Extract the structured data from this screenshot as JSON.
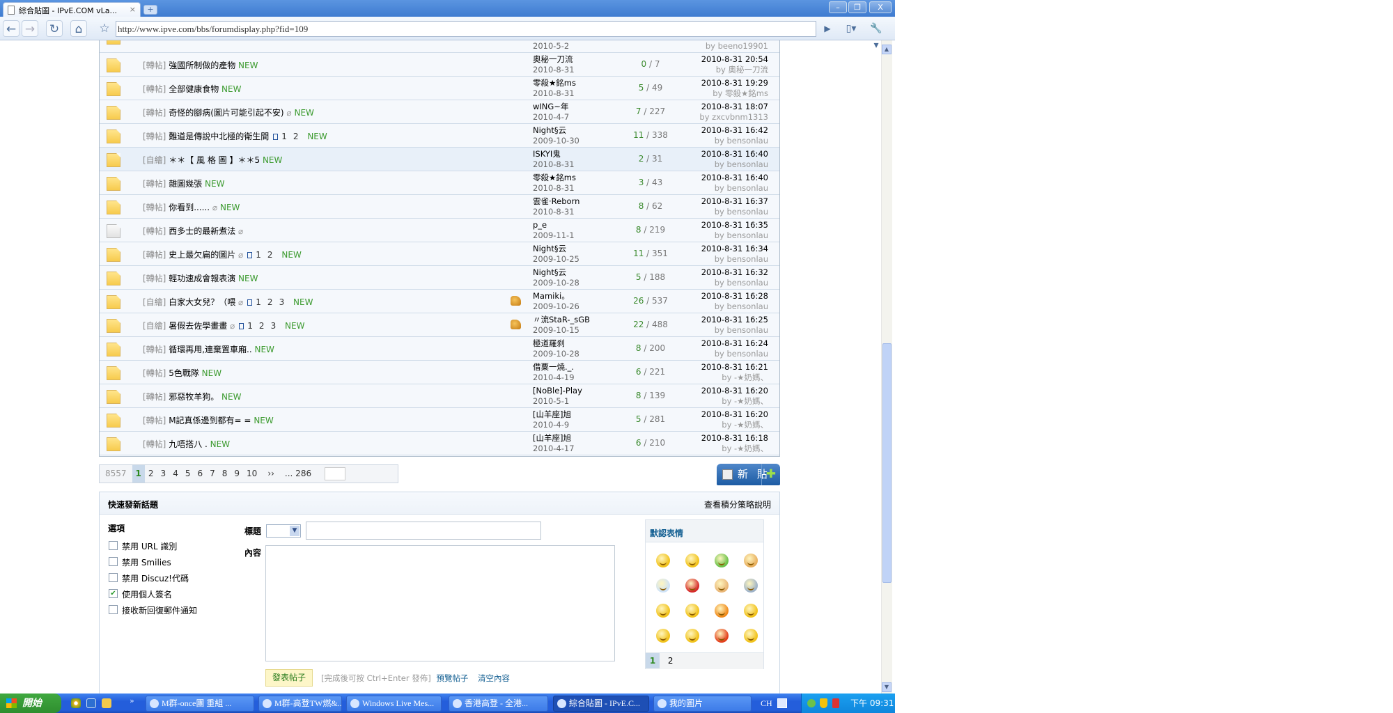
{
  "browser": {
    "tab_title": "綜合貼圖 - IPvE.COM vLa...",
    "url": "http://www.ipve.com/bbs/forumdisplay.php?fid=109"
  },
  "partial_row": {
    "date": "2010-5-2",
    "last_by": "by beeno19901"
  },
  "rows": [
    {
      "prefix": "[轉帖]",
      "title": "強國所制做的產物",
      "attach": false,
      "pages": [],
      "new": "NEW",
      "thumb": false,
      "icon": "new",
      "highlight": false,
      "author": "奧秘一刀流",
      "date": "2010-8-31",
      "replies": "0",
      "views": "7",
      "last_time": "2010-8-31 20:54",
      "last_by": "by 奧秘一刀流"
    },
    {
      "prefix": "[轉帖]",
      "title": "全部健康食物",
      "attach": false,
      "pages": [],
      "new": "NEW",
      "thumb": false,
      "icon": "new",
      "highlight": false,
      "author": "零殺★銘ms",
      "date": "2010-8-31",
      "replies": "5",
      "views": "49",
      "last_time": "2010-8-31 19:29",
      "last_by": "by 零殺★銘ms"
    },
    {
      "prefix": "[轉帖]",
      "title": "奇怪的腳病(圖片可能引起不安)",
      "attach": true,
      "pages": [],
      "new": "NEW",
      "thumb": false,
      "icon": "new",
      "highlight": false,
      "author": "wING~年",
      "date": "2010-4-7",
      "replies": "7",
      "views": "227",
      "last_time": "2010-8-31 18:07",
      "last_by": "by zxcvbnm1313"
    },
    {
      "prefix": "[轉帖]",
      "title": "難道是傳說中北極的衛生間",
      "attach": false,
      "pages": [
        "1",
        "2"
      ],
      "new": "NEW",
      "thumb": false,
      "icon": "new",
      "highlight": false,
      "author": "Night§云",
      "date": "2009-10-30",
      "replies": "11",
      "views": "338",
      "last_time": "2010-8-31 16:42",
      "last_by": "by bensonlau"
    },
    {
      "prefix": "[自繪]",
      "title": "＊＊【 風 格 圖 】＊＊5",
      "attach": false,
      "pages": [],
      "new": "NEW",
      "thumb": false,
      "icon": "new",
      "highlight": true,
      "author": "ISKYI鬼",
      "date": "2010-8-31",
      "replies": "2",
      "views": "31",
      "last_time": "2010-8-31 16:40",
      "last_by": "by bensonlau"
    },
    {
      "prefix": "[轉帖]",
      "title": "雜圖幾張",
      "attach": false,
      "pages": [],
      "new": "NEW",
      "thumb": false,
      "icon": "new",
      "highlight": false,
      "author": "零殺★銘ms",
      "date": "2010-8-31",
      "replies": "3",
      "views": "43",
      "last_time": "2010-8-31 16:40",
      "last_by": "by bensonlau"
    },
    {
      "prefix": "[轉帖]",
      "title": "你看到......",
      "attach": true,
      "pages": [],
      "new": "NEW",
      "thumb": false,
      "icon": "new",
      "highlight": false,
      "author": "雲雀·Reborn",
      "date": "2010-8-31",
      "replies": "8",
      "views": "62",
      "last_time": "2010-8-31 16:37",
      "last_by": "by bensonlau"
    },
    {
      "prefix": "[轉帖]",
      "title": "西多士的最新煮法",
      "attach": true,
      "pages": [],
      "new": "",
      "thumb": false,
      "icon": "old",
      "highlight": false,
      "author": "p_e",
      "date": "2009-11-1",
      "replies": "8",
      "views": "219",
      "last_time": "2010-8-31 16:35",
      "last_by": "by bensonlau"
    },
    {
      "prefix": "[轉帖]",
      "title": "史上最欠扁的圖片",
      "attach": true,
      "pages": [
        "1",
        "2"
      ],
      "new": "NEW",
      "thumb": false,
      "icon": "new",
      "highlight": false,
      "author": "Night§云",
      "date": "2009-10-25",
      "replies": "11",
      "views": "351",
      "last_time": "2010-8-31 16:34",
      "last_by": "by bensonlau"
    },
    {
      "prefix": "[轉帖]",
      "title": "輕功速成會報表演",
      "attach": false,
      "pages": [],
      "new": "NEW",
      "thumb": false,
      "icon": "new",
      "highlight": false,
      "author": "Night§云",
      "date": "2009-10-28",
      "replies": "5",
      "views": "188",
      "last_time": "2010-8-31 16:32",
      "last_by": "by bensonlau"
    },
    {
      "prefix": "[自繪]",
      "title": "白家大女兒？（喂",
      "attach": true,
      "pages": [
        "1",
        "2",
        "3"
      ],
      "new": "NEW",
      "thumb": true,
      "icon": "new",
      "highlight": false,
      "author": "Mamiki。",
      "date": "2009-10-26",
      "replies": "26",
      "views": "537",
      "last_time": "2010-8-31 16:28",
      "last_by": "by bensonlau"
    },
    {
      "prefix": "[自繪]",
      "title": "暑假去佐學畫畫",
      "attach": true,
      "pages": [
        "1",
        "2",
        "3"
      ],
      "new": "NEW",
      "thumb": true,
      "icon": "new",
      "highlight": false,
      "author": "〃流StaR-_sGB",
      "date": "2009-10-15",
      "replies": "22",
      "views": "488",
      "last_time": "2010-8-31 16:25",
      "last_by": "by bensonlau"
    },
    {
      "prefix": "[轉帖]",
      "title": "循環再用,連棄置車廂..",
      "attach": false,
      "pages": [],
      "new": "NEW",
      "thumb": false,
      "icon": "new",
      "highlight": false,
      "author": "極道羅刹",
      "date": "2009-10-28",
      "replies": "8",
      "views": "200",
      "last_time": "2010-8-31 16:24",
      "last_by": "by bensonlau"
    },
    {
      "prefix": "[轉帖]",
      "title": "5色戰隊",
      "attach": false,
      "pages": [],
      "new": "NEW",
      "thumb": false,
      "icon": "new",
      "highlight": false,
      "author": "借粟一燒._.",
      "date": "2010-4-19",
      "replies": "6",
      "views": "221",
      "last_time": "2010-8-31 16:21",
      "last_by": "by -★奶媽、"
    },
    {
      "prefix": "[轉帖]",
      "title": "邪惡牧羊狗。",
      "attach": false,
      "pages": [],
      "new": "NEW",
      "thumb": false,
      "icon": "new",
      "highlight": false,
      "author": "[NoBle]-Play",
      "date": "2010-5-1",
      "replies": "8",
      "views": "139",
      "last_time": "2010-8-31 16:20",
      "last_by": "by -★奶媽、"
    },
    {
      "prefix": "[轉帖]",
      "title": "M記真係邊到都有= =",
      "attach": false,
      "pages": [],
      "new": "NEW",
      "thumb": false,
      "icon": "new",
      "highlight": false,
      "author": "[山羊座]旭",
      "date": "2010-4-9",
      "replies": "5",
      "views": "281",
      "last_time": "2010-8-31 16:20",
      "last_by": "by -★奶媽、"
    },
    {
      "prefix": "[轉帖]",
      "title": "九唔搭八 .",
      "attach": false,
      "pages": [],
      "new": "NEW",
      "thumb": false,
      "icon": "new",
      "highlight": false,
      "author": "[山羊座]旭",
      "date": "2010-4-17",
      "replies": "6",
      "views": "210",
      "last_time": "2010-8-31 16:18",
      "last_by": "by -★奶媽、"
    }
  ],
  "pager": {
    "total": "8557",
    "current": "1",
    "pages": [
      "2",
      "3",
      "4",
      "5",
      "6",
      "7",
      "8",
      "9",
      "10"
    ],
    "next": "››",
    "last": "... 286"
  },
  "new_post_label": "新 貼",
  "quick_post": {
    "title": "快速發新話題",
    "credits_link": "查看積分策略說明",
    "options_heading": "選項",
    "options": [
      {
        "label": "禁用 URL 識別",
        "checked": false
      },
      {
        "label": "禁用 Smilies",
        "checked": false
      },
      {
        "label": "禁用 Discuz!代碼",
        "checked": false
      },
      {
        "label": "使用個人簽名",
        "checked": true
      },
      {
        "label": "接收新回復郵件通知",
        "checked": false
      }
    ],
    "subject_label": "標題",
    "content_label": "內容",
    "smilies_title": "默認表情",
    "smilies_pages": [
      "1",
      "2"
    ],
    "submit_label": "發表帖子",
    "hint": "[完成後可按 Ctrl+Enter 發佈]",
    "preview_link": "預覽帖子",
    "clear_link": "清空內容"
  },
  "taskbar": {
    "start_label": "開始",
    "tasks": [
      "M群-once團 重組 ...",
      "M群-高登TW燃&...",
      "Windows Live Mes...",
      "香港高登 - 全港...",
      "綜合貼圖 - IPvE.C...",
      "我的圖片"
    ],
    "active_task": 4,
    "lang": "CH",
    "clock": "下午 09:31"
  }
}
